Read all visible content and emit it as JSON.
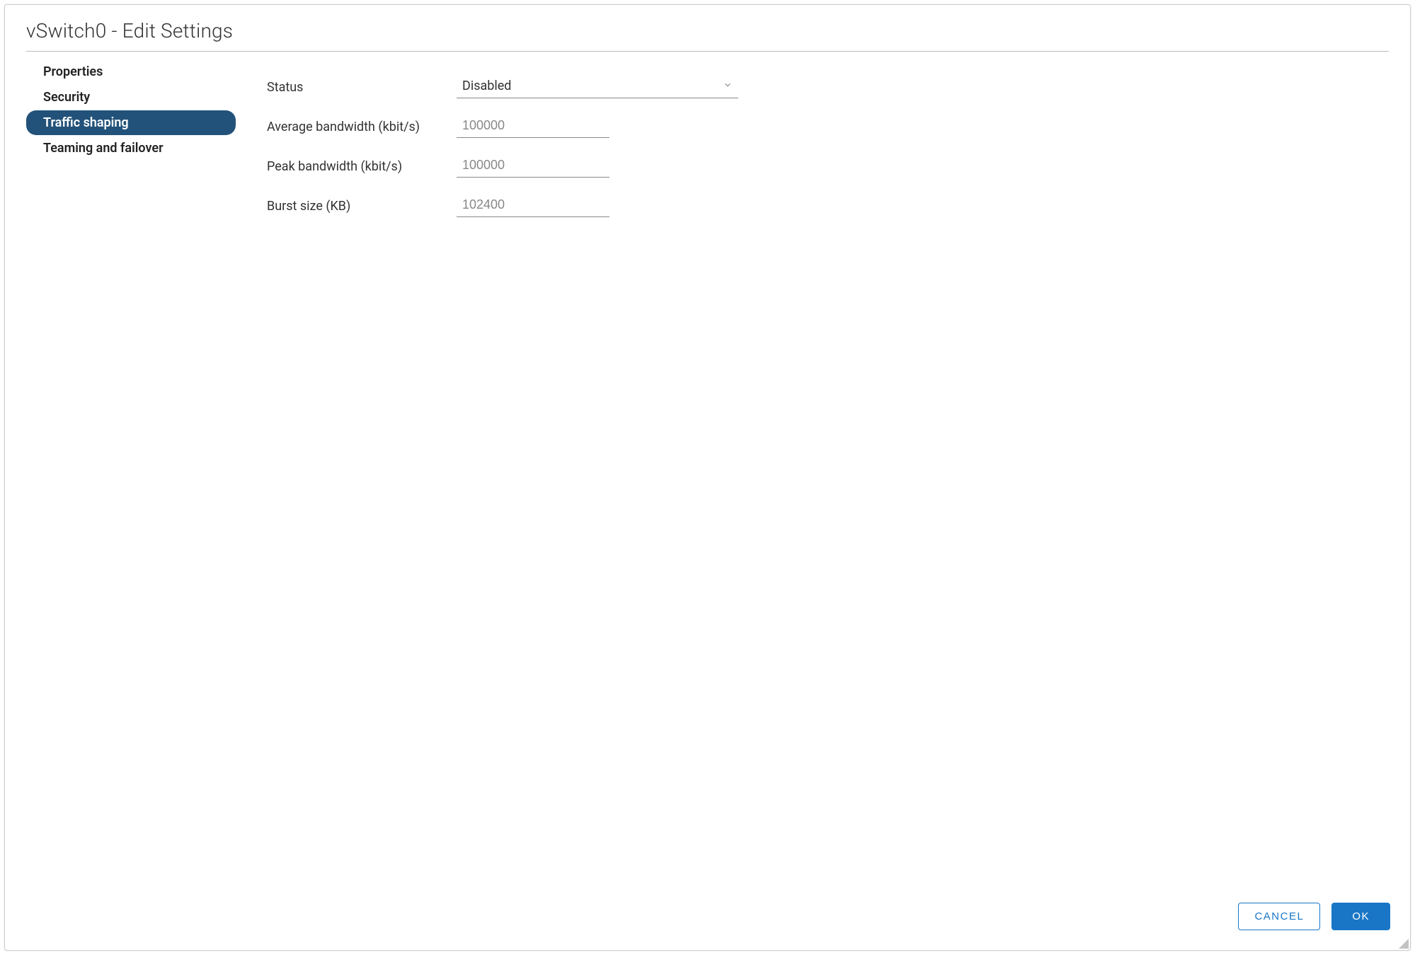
{
  "dialog": {
    "title": "vSwitch0 - Edit Settings"
  },
  "sidebar": {
    "items": [
      {
        "label": "Properties",
        "active": false
      },
      {
        "label": "Security",
        "active": false
      },
      {
        "label": "Traffic shaping",
        "active": true
      },
      {
        "label": "Teaming and failover",
        "active": false
      }
    ]
  },
  "form": {
    "status": {
      "label": "Status",
      "value": "Disabled"
    },
    "avg_bw": {
      "label": "Average bandwidth (kbit/s)",
      "value": "100000"
    },
    "peak_bw": {
      "label": "Peak bandwidth (kbit/s)",
      "value": "100000"
    },
    "burst": {
      "label": "Burst size (KB)",
      "value": "102400"
    }
  },
  "footer": {
    "cancel": "CANCEL",
    "ok": "OK"
  }
}
